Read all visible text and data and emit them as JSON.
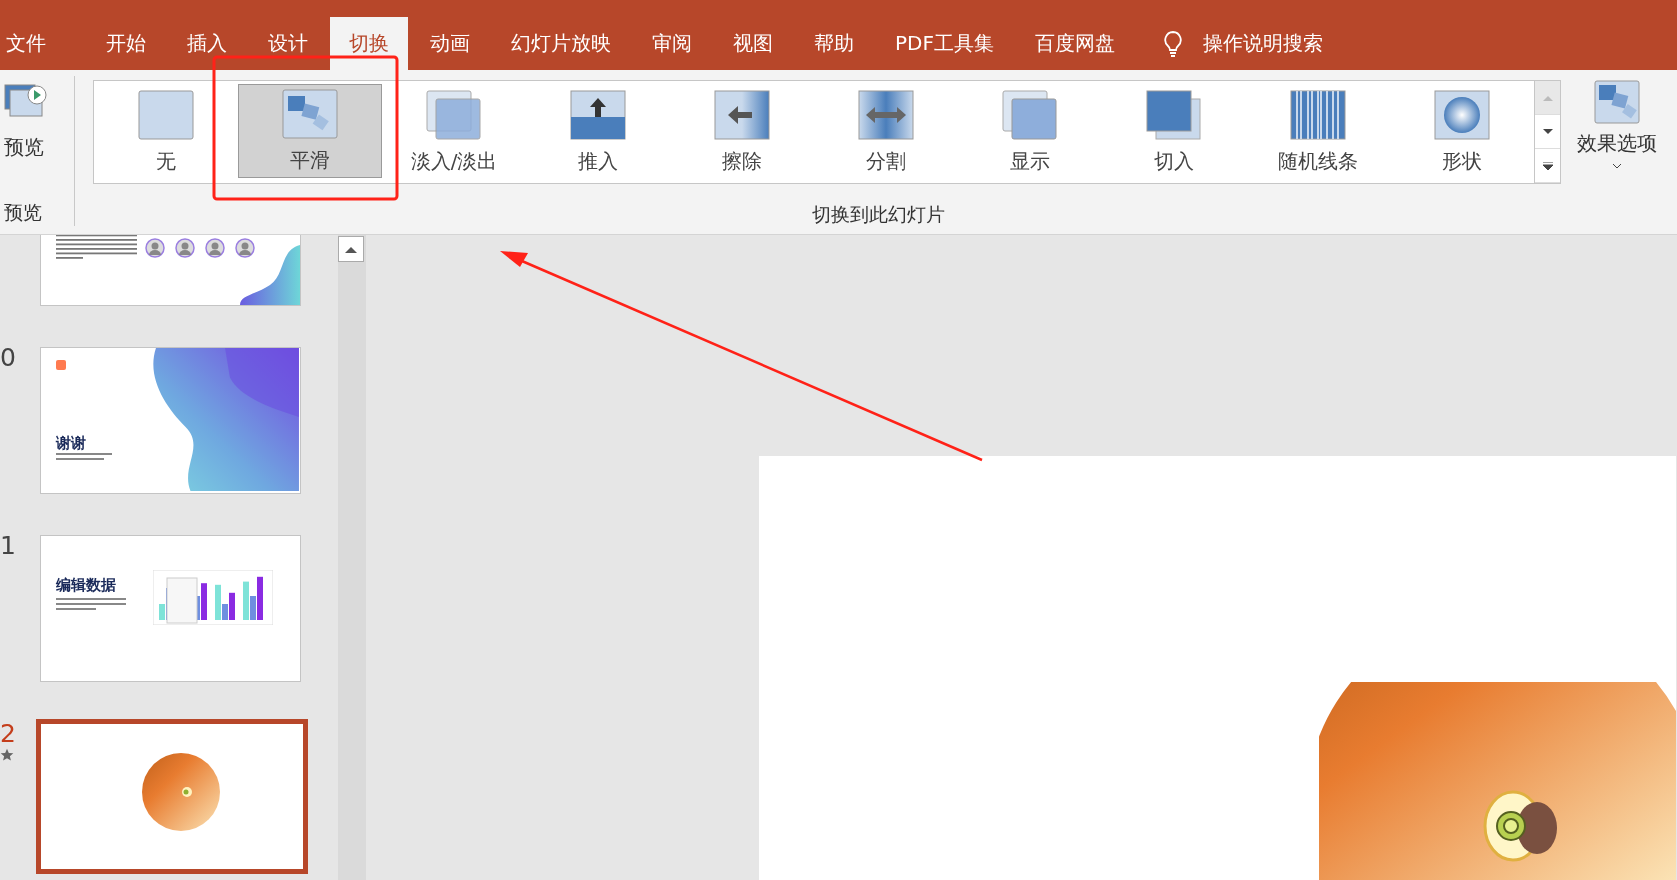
{
  "tabs": [
    {
      "label": "文件",
      "selected": false
    },
    {
      "label": "开始",
      "selected": false
    },
    {
      "label": "插入",
      "selected": false
    },
    {
      "label": "设计",
      "selected": false
    },
    {
      "label": "切换",
      "selected": true
    },
    {
      "label": "动画",
      "selected": false
    },
    {
      "label": "幻灯片放映",
      "selected": false
    },
    {
      "label": "审阅",
      "selected": false
    },
    {
      "label": "视图",
      "selected": false
    },
    {
      "label": "帮助",
      "selected": false
    },
    {
      "label": "PDF工具集",
      "selected": false
    },
    {
      "label": "百度网盘",
      "selected": false
    }
  ],
  "tell_me": {
    "label": "操作说明搜索"
  },
  "preview_group": {
    "button": "预览",
    "group_label": "预览"
  },
  "transitions": {
    "group_label": "切换到此幻灯片",
    "items": [
      {
        "label": "无",
        "kind": "none",
        "selected": false
      },
      {
        "label": "平滑",
        "kind": "morph",
        "selected": true
      },
      {
        "label": "淡入/淡出",
        "kind": "fade",
        "selected": false
      },
      {
        "label": "推入",
        "kind": "push",
        "selected": false
      },
      {
        "label": "擦除",
        "kind": "wipe",
        "selected": false
      },
      {
        "label": "分割",
        "kind": "split",
        "selected": false
      },
      {
        "label": "显示",
        "kind": "reveal",
        "selected": false
      },
      {
        "label": "切入",
        "kind": "cut",
        "selected": false
      },
      {
        "label": "随机线条",
        "kind": "bars",
        "selected": false
      },
      {
        "label": "形状",
        "kind": "shape",
        "selected": false
      }
    ]
  },
  "effect_options": {
    "label": "效果选项"
  },
  "slides": [
    {
      "kind": "team",
      "selected": false,
      "animated": false
    },
    {
      "number": "0",
      "kind": "thanks",
      "title": "谢谢",
      "selected": false,
      "animated": false
    },
    {
      "number": "1",
      "kind": "chart",
      "title": "编辑数据",
      "selected": false,
      "animated": false
    },
    {
      "number": "2",
      "kind": "audio",
      "selected": true,
      "animated": true
    }
  ]
}
